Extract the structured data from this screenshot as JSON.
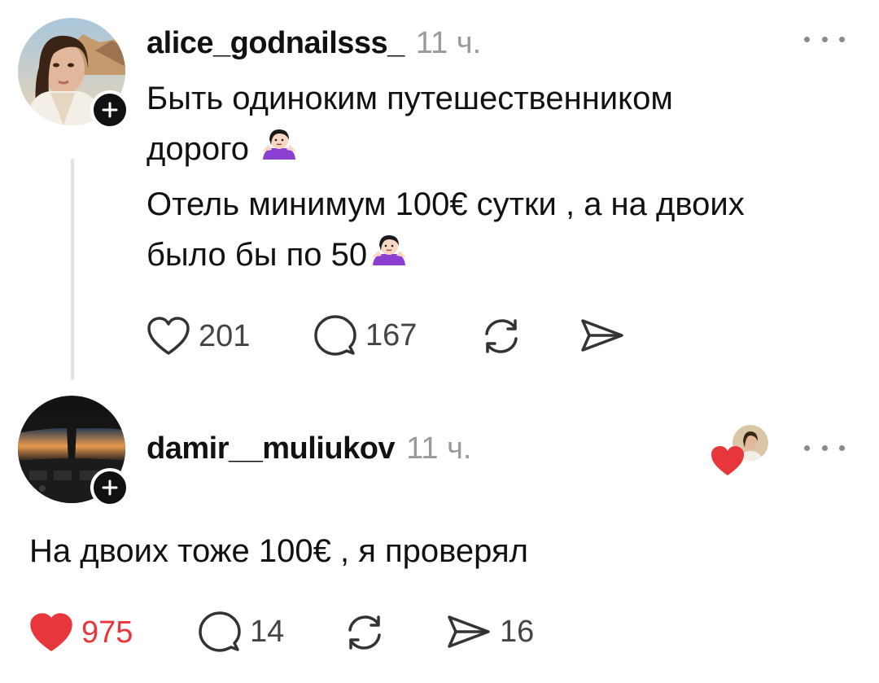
{
  "posts": [
    {
      "username": "alice_godnailsss_",
      "time": "11 ч.",
      "lines": [
        "Быть одиноким путешественником",
        "дорого",
        "Отель минимум 100€ сутки , а на двоих",
        "было бы по 50"
      ],
      "likes": "201",
      "comments": "167",
      "reposts": "",
      "shares": ""
    },
    {
      "username": "damir__muliukov",
      "time": "11 ч.",
      "lines": [
        "На двоих тоже 100€ , я проверял"
      ],
      "likes": "975",
      "comments": "14",
      "reposts": "",
      "shares": "16"
    }
  ],
  "colors": {
    "like_active": "#e8363d",
    "muted": "#9a9a9a",
    "text": "#111111"
  },
  "icons": [
    "heart-icon",
    "comment-icon",
    "repost-icon",
    "share-icon",
    "plus-icon",
    "more-icon",
    "shrug-emoji"
  ]
}
